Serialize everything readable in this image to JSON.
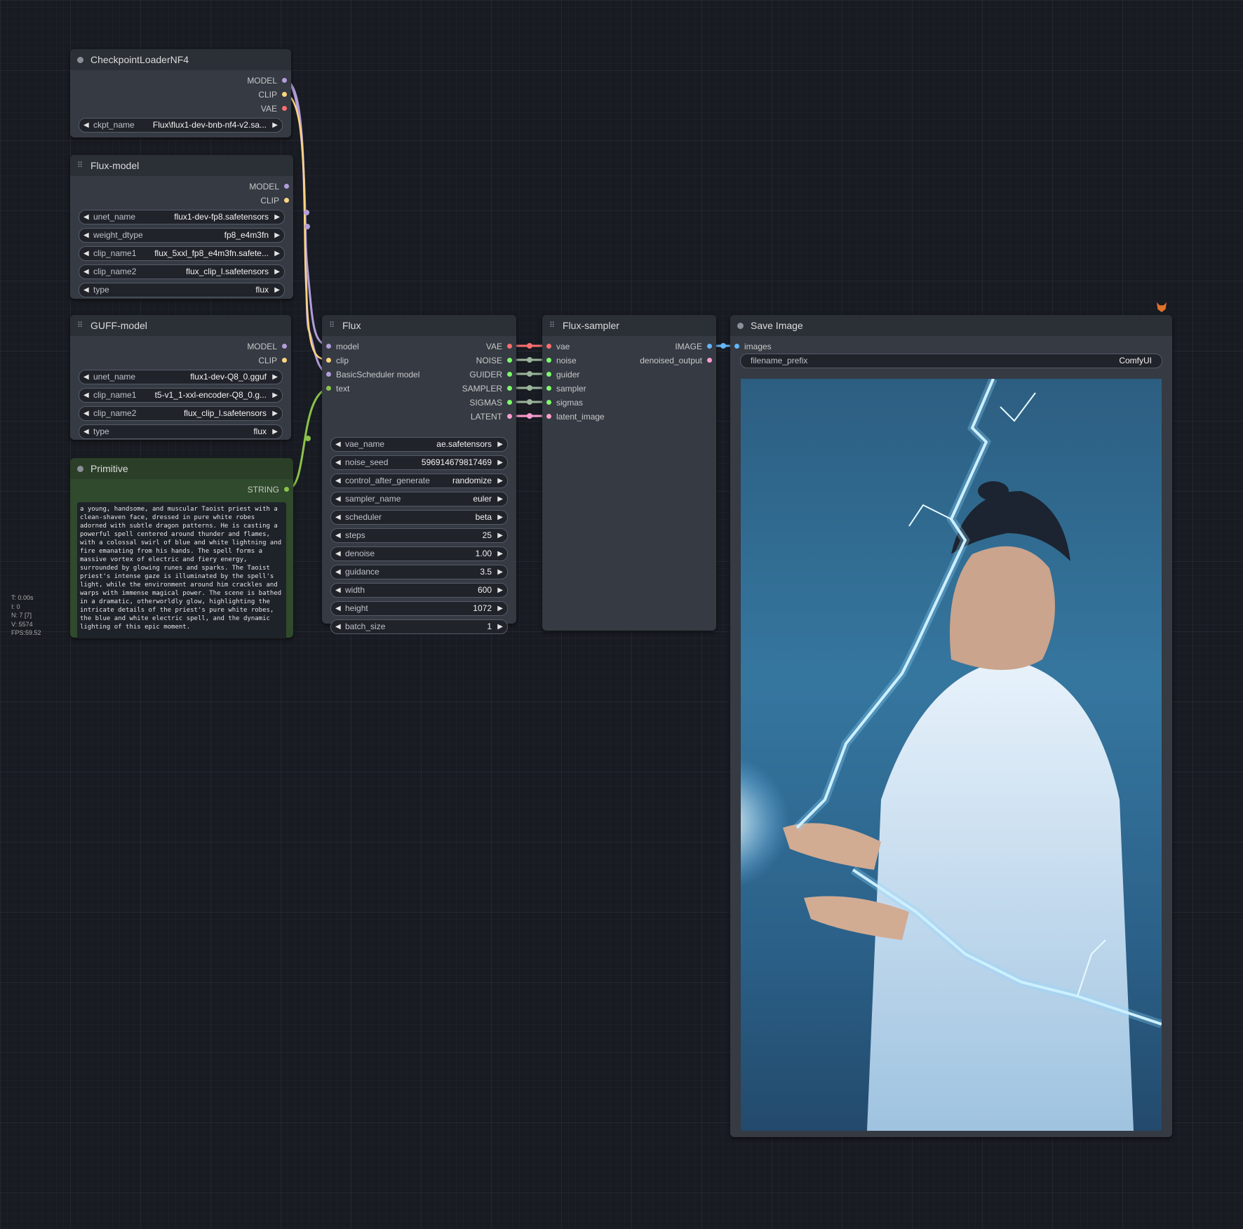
{
  "stats": {
    "t": "T: 0.00s",
    "i": "I: 0",
    "n": "N: 7 [7]",
    "v": "V: 5574",
    "fps": "FPS:59.52"
  },
  "nodes": {
    "checkpoint": {
      "title": "CheckpointLoaderNF4",
      "outputs": [
        "MODEL",
        "CLIP",
        "VAE"
      ],
      "widgets": [
        {
          "label": "ckpt_name",
          "value": "Flux\\flux1-dev-bnb-nf4-v2.sa..."
        }
      ]
    },
    "flux_model": {
      "title": "Flux-model",
      "outputs": [
        "MODEL",
        "CLIP"
      ],
      "widgets": [
        {
          "label": "unet_name",
          "value": "flux1-dev-fp8.safetensors"
        },
        {
          "label": "weight_dtype",
          "value": "fp8_e4m3fn"
        },
        {
          "label": "clip_name1",
          "value": "flux_5xxl_fp8_e4m3fn.safete..."
        },
        {
          "label": "clip_name2",
          "value": "flux_clip_l.safetensors"
        },
        {
          "label": "type",
          "value": "flux"
        }
      ]
    },
    "guff_model": {
      "title": "GUFF-model",
      "outputs": [
        "MODEL",
        "CLIP"
      ],
      "widgets": [
        {
          "label": "unet_name",
          "value": "flux1-dev-Q8_0.gguf"
        },
        {
          "label": "clip_name1",
          "value": "t5-v1_1-xxl-encoder-Q8_0.g..."
        },
        {
          "label": "clip_name2",
          "value": "flux_clip_l.safetensors"
        },
        {
          "label": "type",
          "value": "flux"
        }
      ]
    },
    "primitive": {
      "title": "Primitive",
      "output": "STRING",
      "text": "a young, handsome, and muscular Taoist priest with a clean-shaven face, dressed in pure white robes adorned with subtle dragon patterns. He is casting a powerful spell centered around thunder and flames, with a colossal swirl of blue and white lightning and fire emanating from his hands. The spell forms a massive vortex of electric and fiery energy, surrounded by glowing runes and sparks. The Taoist priest's intense gaze is illuminated by the spell's light, while the environment around him crackles and warps with immense magical power. The scene is bathed in a dramatic, otherworldly glow, highlighting the intricate details of the priest's pure white robes, the blue and white electric spell, and the dynamic lighting of this epic moment."
    },
    "flux": {
      "title": "Flux",
      "inputs": [
        "model",
        "clip",
        "BasicScheduler model",
        "text"
      ],
      "outputs": [
        "VAE",
        "NOISE",
        "GUIDER",
        "SAMPLER",
        "SIGMAS",
        "LATENT"
      ],
      "widgets": [
        {
          "label": "vae_name",
          "value": "ae.safetensors"
        },
        {
          "label": "noise_seed",
          "value": "596914679817469"
        },
        {
          "label": "control_after_generate",
          "value": "randomize"
        },
        {
          "label": "sampler_name",
          "value": "euler"
        },
        {
          "label": "scheduler",
          "value": "beta"
        },
        {
          "label": "steps",
          "value": "25"
        },
        {
          "label": "denoise",
          "value": "1.00"
        },
        {
          "label": "guidance",
          "value": "3.5"
        },
        {
          "label": "width",
          "value": "600"
        },
        {
          "label": "height",
          "value": "1072"
        },
        {
          "label": "batch_size",
          "value": "1"
        }
      ]
    },
    "flux_sampler": {
      "title": "Flux-sampler",
      "inputs": [
        "vae",
        "noise",
        "guider",
        "sampler",
        "sigmas",
        "latent_image"
      ],
      "outputs": [
        "IMAGE",
        "denoised_output"
      ]
    },
    "save_image": {
      "title": "Save Image",
      "inputs": [
        "images"
      ],
      "widgets": [
        {
          "label": "filename_prefix",
          "value": "ComfyUI"
        }
      ],
      "preview_icon": "fox-icon"
    }
  },
  "colors": {
    "model": "#b39ddb",
    "clip": "#ffd580",
    "vae": "#ff6e6e",
    "green": "#7cfc6a",
    "latent": "#ff9ccf",
    "image": "#64b5f6",
    "text_link": "#8bc34a",
    "primitive_bg": "#2f4a2c",
    "primitive_header": "#2b3f28"
  }
}
